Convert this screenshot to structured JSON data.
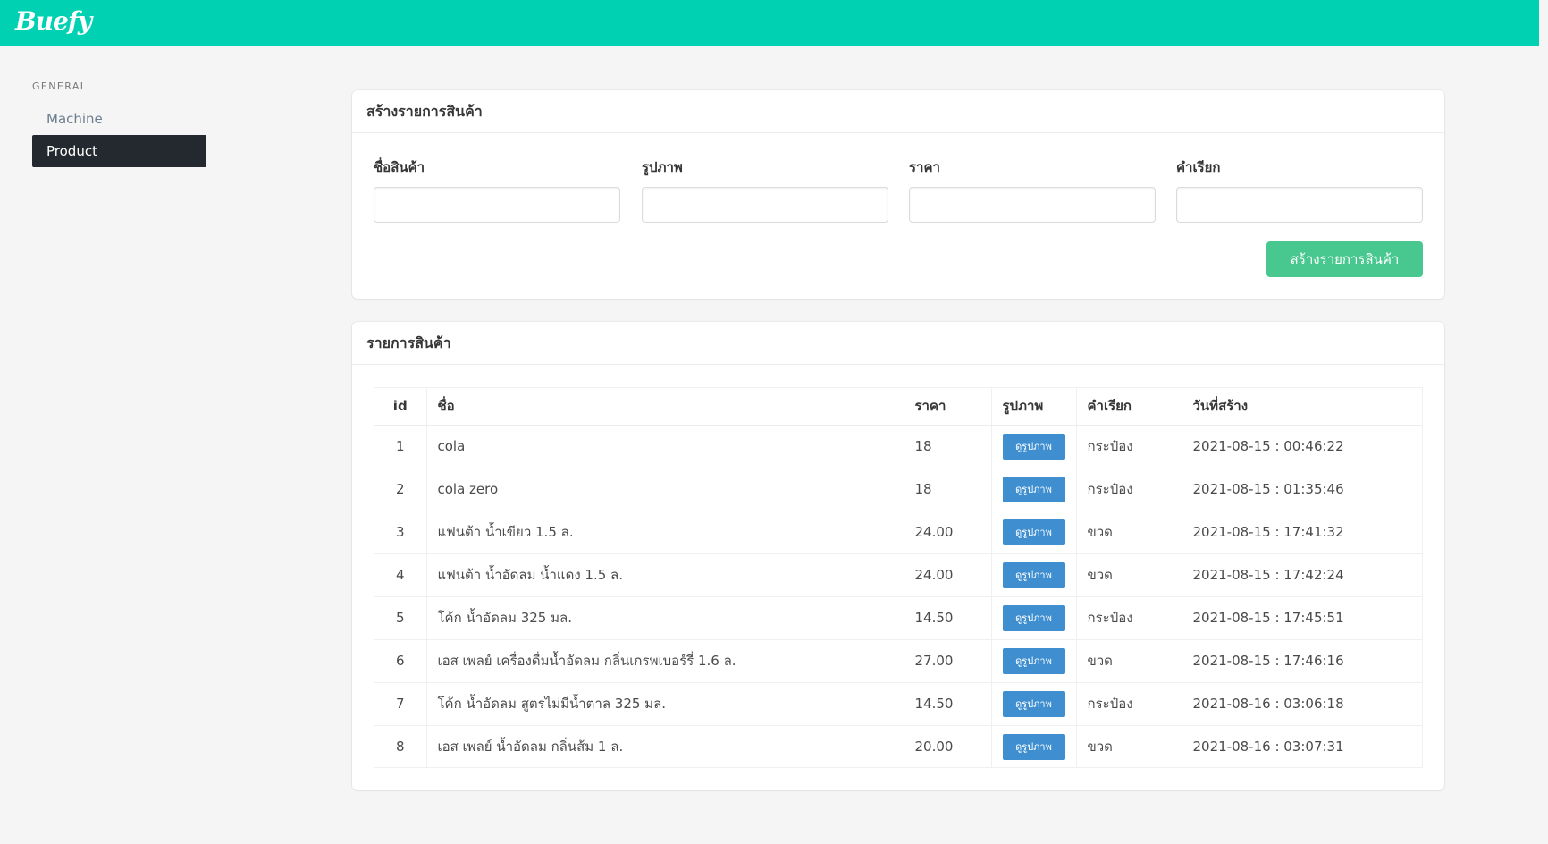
{
  "navbar": {
    "brand": "Buefy"
  },
  "sidebar": {
    "label": "GENERAL",
    "items": [
      {
        "label": "Machine",
        "active": false
      },
      {
        "label": "Product",
        "active": true
      }
    ]
  },
  "create_form": {
    "title": "สร้างรายการสินค้า",
    "fields": [
      {
        "label": "ชื่อสินค้า",
        "value": ""
      },
      {
        "label": "รูปภาพ",
        "value": ""
      },
      {
        "label": "ราคา",
        "value": ""
      },
      {
        "label": "คำเรียก",
        "value": ""
      }
    ],
    "submit_label": "สร้างรายการสินค้า"
  },
  "product_list": {
    "title": "รายการสินค้า",
    "columns": [
      "id",
      "ชื่อ",
      "ราคา",
      "รูปภาพ",
      "คำเรียก",
      "วันที่สร้าง"
    ],
    "view_button_label": "ดูรูปภาพ",
    "rows": [
      {
        "id": "1",
        "name": "cola",
        "price": "18",
        "unit": "กระป๋อง",
        "created": "2021-08-15 : 00:46:22"
      },
      {
        "id": "2",
        "name": "cola zero",
        "price": "18",
        "unit": "กระป๋อง",
        "created": "2021-08-15 : 01:35:46"
      },
      {
        "id": "3",
        "name": "แฟนต้า น้ำเขียว 1.5 ล.",
        "price": "24.00",
        "unit": "ขวด",
        "created": "2021-08-15 : 17:41:32"
      },
      {
        "id": "4",
        "name": "แฟนต้า น้ำอัดลม น้ำแดง 1.5 ล.",
        "price": "24.00",
        "unit": "ขวด",
        "created": "2021-08-15 : 17:42:24"
      },
      {
        "id": "5",
        "name": "โค้ก น้ำอัดลม 325 มล.",
        "price": "14.50",
        "unit": "กระป๋อง",
        "created": "2021-08-15 : 17:45:51"
      },
      {
        "id": "6",
        "name": "เอส เพลย์ เครื่องดื่มน้ำอัดลม กลิ่นเกรพเบอร์รี่ 1.6 ล.",
        "price": "27.00",
        "unit": "ขวด",
        "created": "2021-08-15 : 17:46:16"
      },
      {
        "id": "7",
        "name": "โค้ก น้ำอัดลม สูตรไม่มีน้ำตาล 325 มล.",
        "price": "14.50",
        "unit": "กระป๋อง",
        "created": "2021-08-16 : 03:06:18"
      },
      {
        "id": "8",
        "name": "เอส เพลย์ น้ำอัดลม กลิ่นส้ม 1 ล.",
        "price": "20.00",
        "unit": "ขวด",
        "created": "2021-08-16 : 03:07:31"
      }
    ]
  },
  "colors": {
    "navbar": "#00d1b2",
    "success": "#48c78e",
    "info": "#3e8ed0",
    "sidebar_active": "#24292f"
  }
}
